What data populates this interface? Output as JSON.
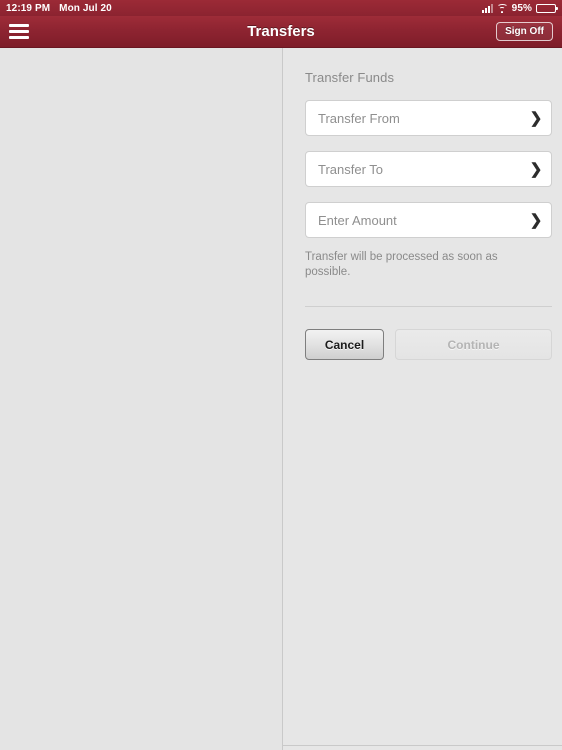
{
  "status_bar": {
    "time": "12:19 PM",
    "date": "Mon Jul 20",
    "signal_icon": "signal-bars-icon",
    "wifi_icon": "wifi-icon",
    "battery_percent": "95%",
    "battery_icon": "battery-icon"
  },
  "nav_bar": {
    "menu_icon": "hamburger-menu-icon",
    "title": "Transfers",
    "sign_off_label": "Sign Off",
    "background_color": "#8e2431"
  },
  "main": {
    "section_title": "Transfer Funds",
    "fields": [
      {
        "label": "Transfer From",
        "chevron": "❯",
        "icon_name": "chevron-right-icon"
      },
      {
        "label": "Transfer To",
        "chevron": "❯",
        "icon_name": "chevron-right-icon"
      },
      {
        "label": "Enter Amount",
        "chevron": "❯",
        "icon_name": "chevron-right-icon"
      }
    ],
    "helper_text": "Transfer will be processed as soon as possible.",
    "buttons": {
      "cancel_label": "Cancel",
      "continue_label": "Continue",
      "continue_disabled": true
    }
  },
  "colors": {
    "brand": "#8e2431",
    "page_background": "#e6e6e6",
    "field_background": "#ffffff",
    "muted_text": "#8a8a8a"
  }
}
